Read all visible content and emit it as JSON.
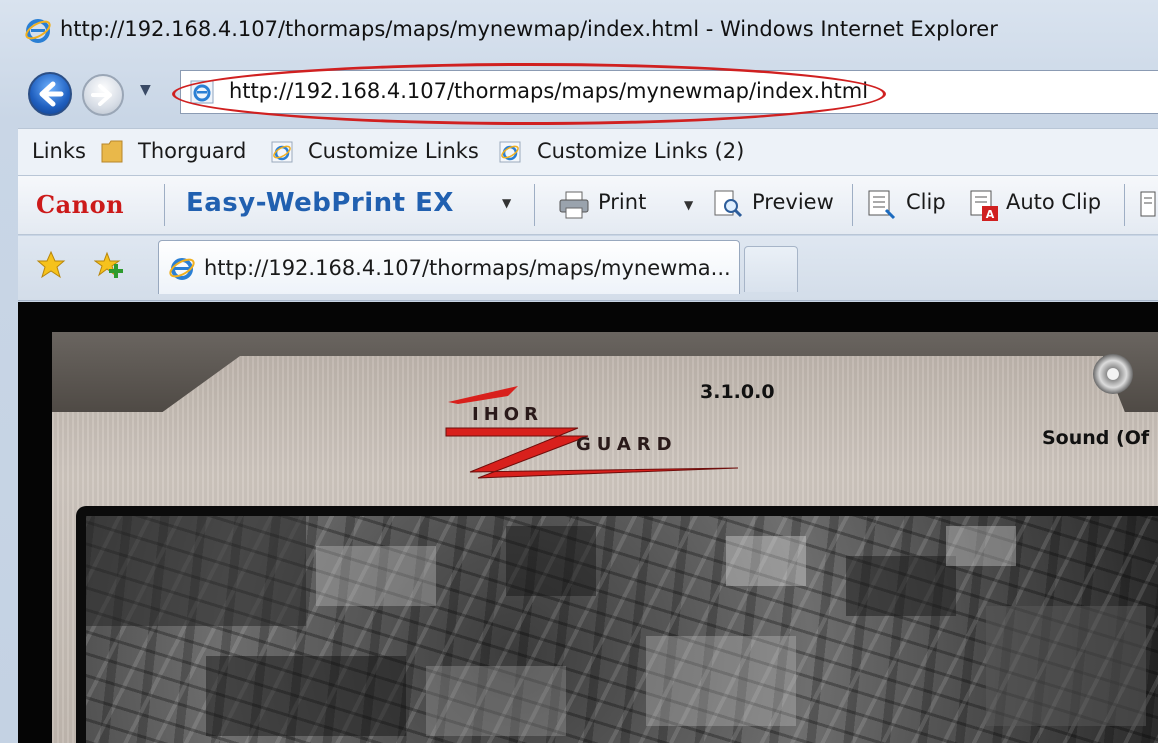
{
  "window": {
    "title": "http://192.168.4.107/thormaps/maps/mynewmap/index.html - Windows Internet Explorer"
  },
  "address_bar": {
    "url": "http://192.168.4.107/thormaps/maps/mynewmap/index.html"
  },
  "links_bar": {
    "label": "Links",
    "items": [
      "Thorguard",
      "Customize Links",
      "Customize Links (2)"
    ]
  },
  "canon_toolbar": {
    "brand": "Canon",
    "product": "Easy-WebPrint EX",
    "print": "Print",
    "preview": "Preview",
    "clip": "Clip",
    "auto_clip": "Auto Clip"
  },
  "tab": {
    "label": "http://192.168.4.107/thormaps/maps/mynewma..."
  },
  "page": {
    "version": "3.1.0.0",
    "sound_label": "Sound (Of",
    "logo_top": "IHOR",
    "logo_bottom": "GUARD"
  },
  "colors": {
    "highlight_ellipse": "#d02020",
    "canon_red": "#cc1a1a",
    "ewp_blue": "#2160b0",
    "logo_red": "#d8201c"
  }
}
